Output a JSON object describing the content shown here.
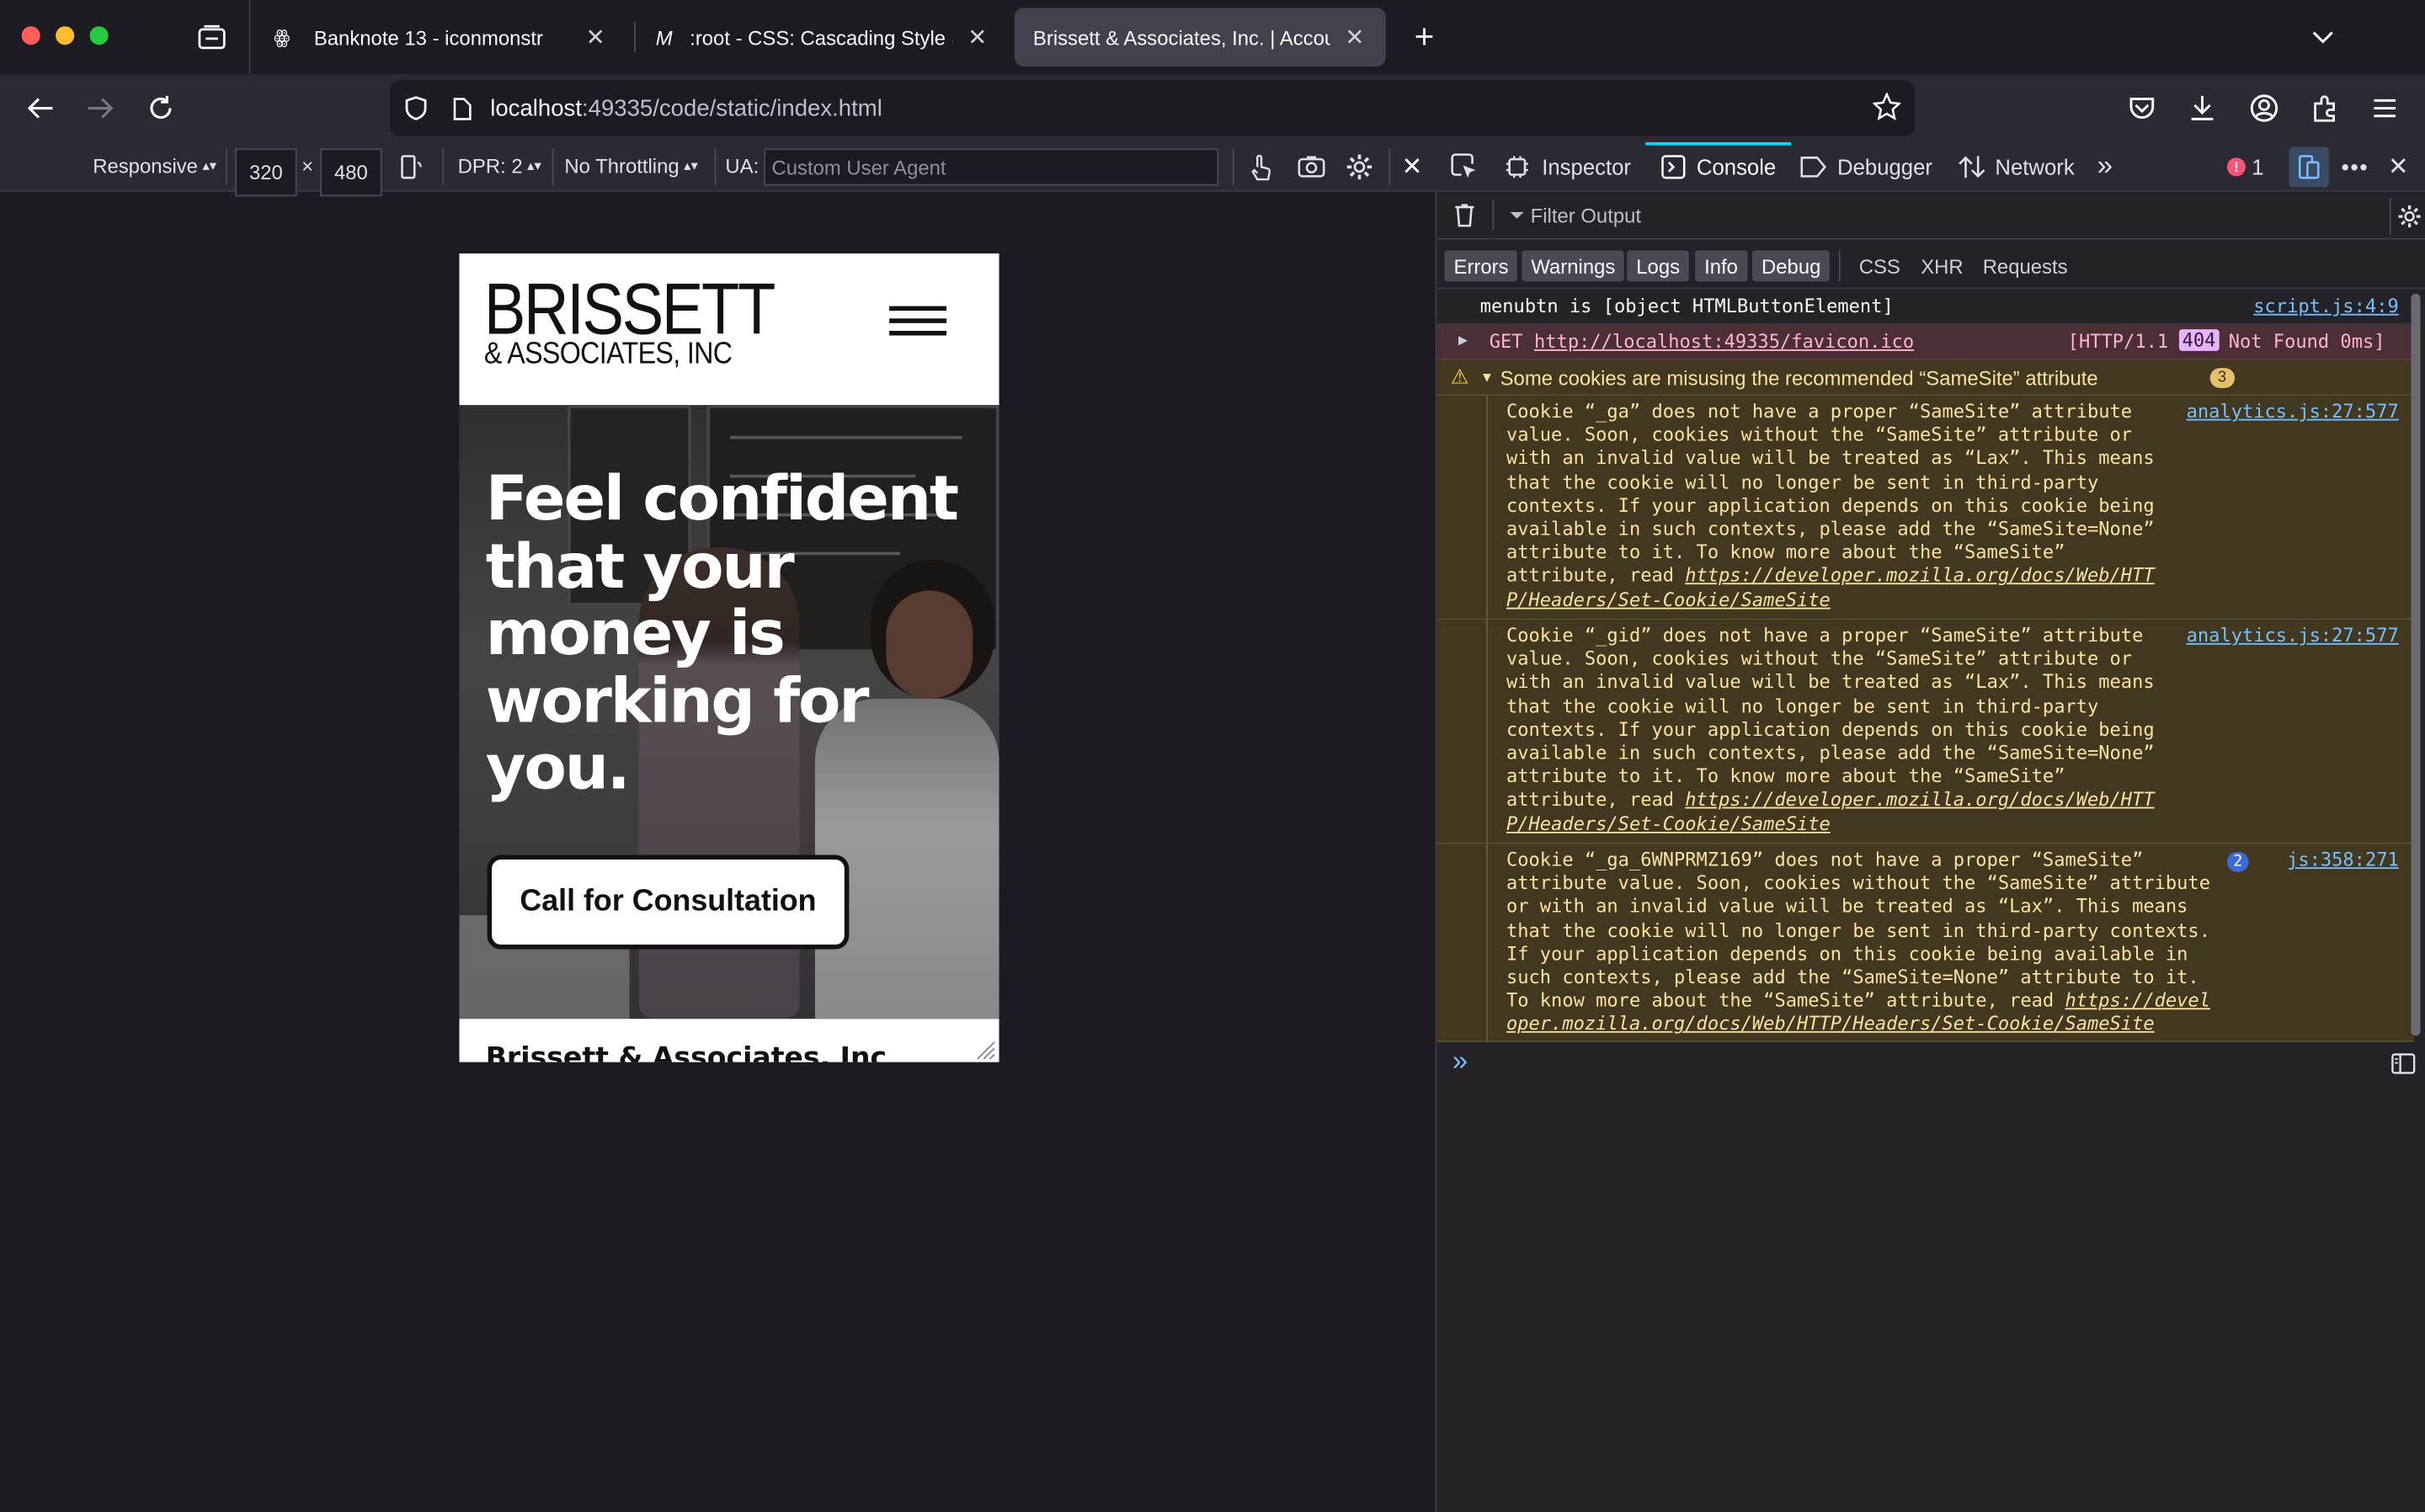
{
  "browser": {
    "tabs": [
      {
        "label": "Banknote 13 - iconmonstr",
        "icon": "iconmonstr-icon",
        "active": false
      },
      {
        "label": ":root - CSS: Cascading Style Sh",
        "icon": "mdn-icon",
        "active": false
      },
      {
        "label": "Brissett & Associates, Inc. | Account",
        "icon": "none",
        "active": true
      }
    ],
    "url": {
      "host": "localhost",
      "rest": ":49335/code/static/index.html"
    }
  },
  "rdm_toolbar": {
    "device": "Responsive",
    "width": "320",
    "times": "×",
    "height": "480",
    "dpr": "DPR: 2",
    "throttling": "No Throttling",
    "ua_label": "UA:",
    "ua_placeholder": "Custom User Agent"
  },
  "devtools": {
    "tabs": [
      "Inspector",
      "Console",
      "Debugger",
      "Network"
    ],
    "active_tab": "Console",
    "error_count": "1",
    "filter_placeholder": "Filter Output",
    "level_filters": [
      "Errors",
      "Warnings",
      "Logs",
      "Info",
      "Debug"
    ],
    "type_filters": [
      "CSS",
      "XHR",
      "Requests"
    ]
  },
  "console": {
    "log": {
      "text": "menubtn is [object HTMLButtonElement]",
      "source": "script.js:4:9"
    },
    "error": {
      "method": "GET",
      "url": "http://localhost:49335/favicon.ico",
      "status_pre": "[HTTP/1.1",
      "code": "404",
      "status_post": "Not Found 0ms]"
    },
    "warning_group": {
      "text": "Some cookies are misusing the recommended “SameSite” attribute",
      "count": "3"
    },
    "warnings": [
      {
        "lines": [
          "Cookie “_ga” does not have a proper “SameSite” attribute",
          "value. Soon, cookies without the “SameSite” attribute or",
          "with an invalid value will be treated as “Lax”. This means",
          "that the cookie will no longer be sent in third-party",
          "contexts. If your application depends on this cookie being",
          "available in such contexts, please add the “SameSite=None”",
          "attribute to it. To know more about the “SameSite”",
          "attribute, read "
        ],
        "link": [
          "https://developer.mozilla.org/docs/Web/HTT",
          "P/Headers/Set-Cookie/SameSite"
        ],
        "source": "analytics.js:27:577"
      },
      {
        "lines": [
          "Cookie “_gid” does not have a proper “SameSite” attribute",
          "value. Soon, cookies without the “SameSite” attribute or",
          "with an invalid value will be treated as “Lax”. This means",
          "that the cookie will no longer be sent in third-party",
          "contexts. If your application depends on this cookie being",
          "available in such contexts, please add the “SameSite=None”",
          "attribute to it. To know more about the “SameSite”",
          "attribute, read "
        ],
        "link": [
          "https://developer.mozilla.org/docs/Web/HTT",
          "P/Headers/Set-Cookie/SameSite"
        ],
        "source": "analytics.js:27:577"
      },
      {
        "lines": [
          "Cookie “_ga_6WNPRMZ169” does not have a proper “SameSite”",
          "attribute value. Soon, cookies without the “SameSite” attribute",
          "or with an invalid value will be treated as “Lax”. This means",
          "that the cookie will no longer be sent in third-party contexts.",
          "If your application depends on this cookie being available in",
          "such contexts, please add the “SameSite=None” attribute to it.",
          "To know more about the “SameSite” attribute, read "
        ],
        "link": [
          "https://devel",
          "oper.mozilla.org/docs/Web/HTTP/Headers/Set-Cookie/SameSite"
        ],
        "repeat": "2",
        "source": "js:358:271"
      }
    ],
    "prompt": "»"
  },
  "site": {
    "logo_line1": "BRISSETT",
    "logo_line2": "& ASSOCIATES, INC",
    "headline": [
      "Feel confident",
      "that your",
      "money is",
      "working for",
      "you."
    ],
    "cta": "Call for Consultation",
    "section_title": "Brissett & Associates, Inc"
  }
}
